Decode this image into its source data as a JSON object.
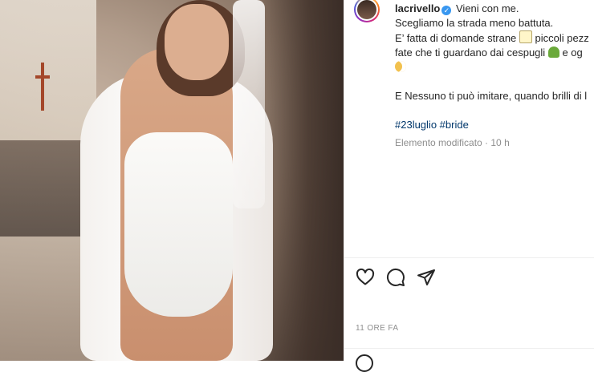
{
  "post": {
    "username": "lacrivello",
    "first_line_text": "Vieni con me.",
    "line2": "Scegliamo la strada meno battuta.",
    "line3_a": "E’ fatta di domande strane",
    "line3_b": "piccoli pezz",
    "line4_a": "fate che ti guardano dai cespugli",
    "line4_b": "e og",
    "line6": "E Nessuno ti può imitare, quando brilli di l",
    "hashtags": [
      "#23luglio",
      "#bride"
    ],
    "edited_meta": "Elemento modificato · 10 h",
    "timestamp": "11 ORE FA"
  },
  "icons": {
    "verified": "verified-badge-icon",
    "like": "heart-icon",
    "comment": "comment-bubble-icon",
    "share": "paper-plane-icon",
    "emoji": "smiley-icon"
  },
  "colors": {
    "hashtag": "#00376b",
    "verified": "#3897f0",
    "meta": "#8e8e8e"
  }
}
